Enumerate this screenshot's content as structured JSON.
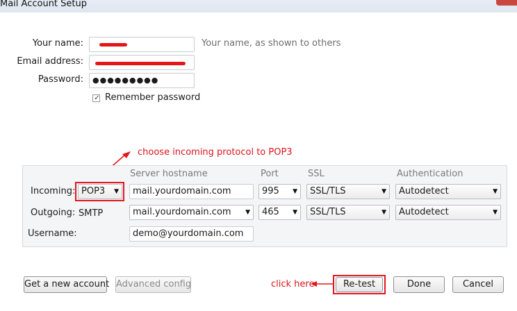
{
  "window": {
    "title": "Mail Account Setup"
  },
  "form": {
    "name_label": "Your name:",
    "name_hint": "Your name, as shown to others",
    "email_label": "Email address:",
    "password_label": "Password:",
    "password_value": "●●●●●●●●●",
    "remember_label": "Remember password",
    "remember_checked": true
  },
  "server": {
    "col_hostname": "Server hostname",
    "col_port": "Port",
    "col_ssl": "SSL",
    "col_auth": "Authentication",
    "incoming_label": "Incoming:",
    "incoming_protocol": "POP3",
    "incoming_host": "mail.yourdomain.com",
    "incoming_port": "995",
    "incoming_ssl": "SSL/TLS",
    "incoming_auth": "Autodetect",
    "outgoing_label": "Outgoing:",
    "outgoing_protocol": "SMTP",
    "outgoing_host": "mail.yourdomain.com",
    "outgoing_port": "465",
    "outgoing_ssl": "SSL/TLS",
    "outgoing_auth": "Autodetect",
    "username_label": "Username:",
    "username_value": "demo@yourdomain.com"
  },
  "buttons": {
    "get_account": "Get a new account",
    "advanced": "Advanced config",
    "retest": "Re-test",
    "done": "Done",
    "cancel": "Cancel"
  },
  "annotations": {
    "protocol_note": "choose incoming protocol to POP3",
    "click_note": "click  here",
    "color": "#e3161c"
  }
}
